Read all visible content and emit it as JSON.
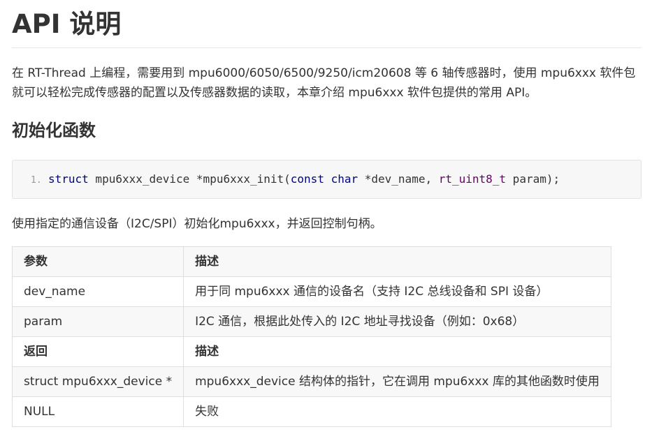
{
  "title": "API 说明",
  "intro": "在 RT-Thread 上编程，需要用到 mpu6000/6050/6500/9250/icm20608 等 6 轴传感器时，使用 mpu6xxx 软件包就可以轻松完成传感器的配置以及传感器数据的读取，本章介绍 mpu6xxx 软件包提供的常用 API。",
  "section": {
    "heading": "初始化函数",
    "code": {
      "line_number": "1.",
      "tokens": {
        "struct": "struct",
        "type": " mpu6xxx_device ",
        "func": "*mpu6xxx_init(",
        "const": "const",
        "sp1": " ",
        "char": "char",
        "arg1": " *dev_name, ",
        "rt_type": "rt_uint8_t",
        "arg2": " param);"
      }
    },
    "description": "使用指定的通信设备（I2C/SPI）初始化mpu6xxx，并返回控制句柄。",
    "table": {
      "header": {
        "col1": "参数",
        "col2": "描述"
      },
      "rows": [
        {
          "col1": "dev_name",
          "col2": "用于同 mpu6xxx 通信的设备名（支持 I2C 总线设备和 SPI 设备）"
        },
        {
          "col1": "param",
          "col2": "I2C 通信，根据此处传入的 I2C 地址寻找设备（例如：0x68）"
        }
      ],
      "return_header": {
        "col1": "返回",
        "col2": "描述"
      },
      "return_rows": [
        {
          "col1": "struct mpu6xxx_device *",
          "col2": "mpu6xxx_device 结构体的指针，它在调用 mpu6xxx 库的其他函数时使用"
        },
        {
          "col1": "NULL",
          "col2": "失败"
        }
      ]
    }
  }
}
